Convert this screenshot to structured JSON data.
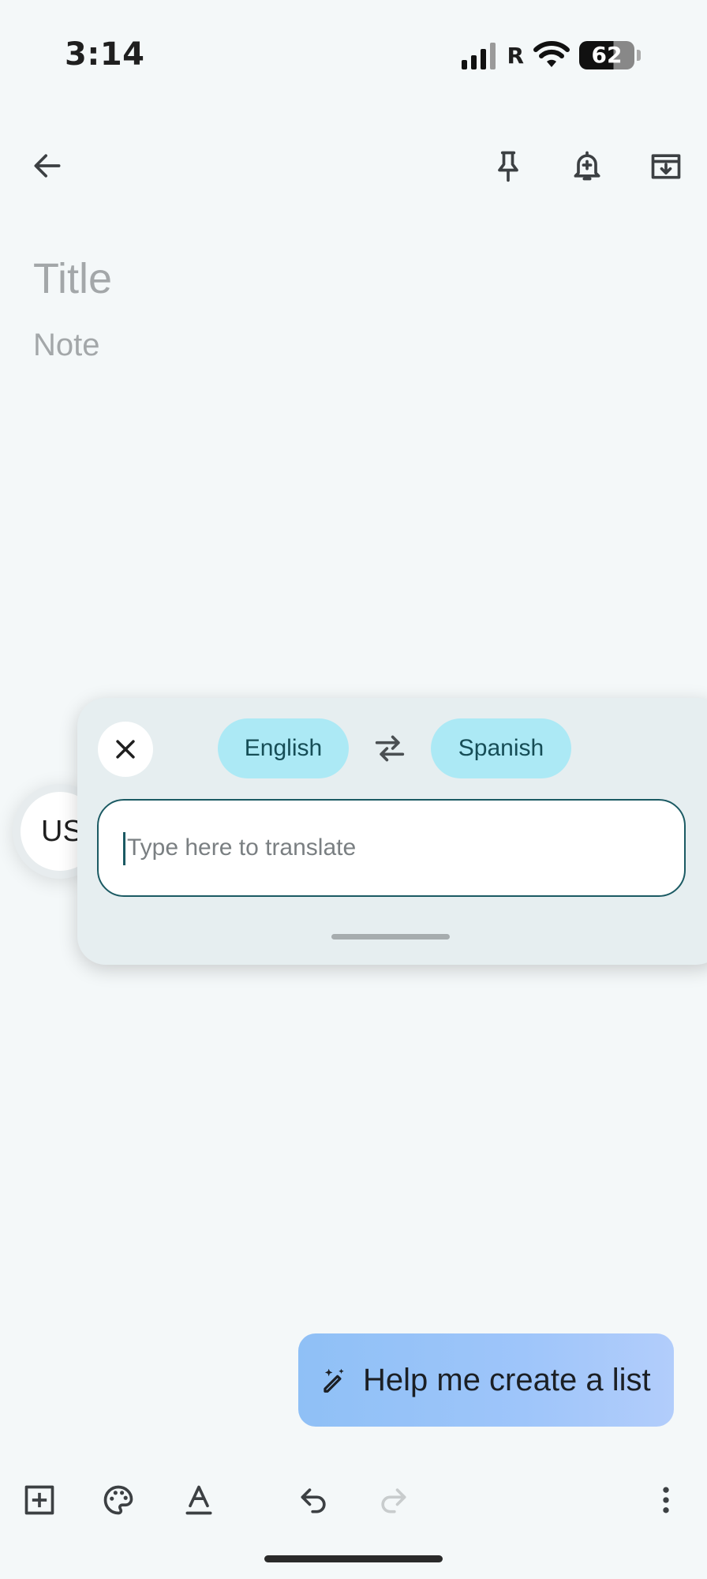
{
  "status_bar": {
    "time": "3:14",
    "carrier_flag": "R",
    "battery": "62"
  },
  "editor": {
    "title_placeholder": "Title",
    "note_placeholder": "Note"
  },
  "side_bubble": {
    "label": "US"
  },
  "translate": {
    "source_language": "English",
    "target_language": "Spanish",
    "input_placeholder": "Type here to translate",
    "input_value": ""
  },
  "help_button": {
    "label": "Help me create a list"
  },
  "icons": {
    "back": "arrow-left-icon",
    "pin": "pin-icon",
    "reminder": "bell-plus-icon",
    "archive": "archive-icon",
    "close": "close-icon",
    "swap": "swap-arrows-icon",
    "sparkle": "pen-sparkle-icon",
    "add": "add-box-icon",
    "palette": "palette-icon",
    "text_format": "text-format-icon",
    "undo": "undo-icon",
    "redo": "redo-icon",
    "more": "more-vert-icon"
  },
  "colors": {
    "background": "#f4f8f9",
    "panel": "#e6eef0",
    "chip": "#ace9f5",
    "chip_text": "#164d56",
    "accent_border": "#1b5a63",
    "help_button": "#9ec5fa"
  }
}
